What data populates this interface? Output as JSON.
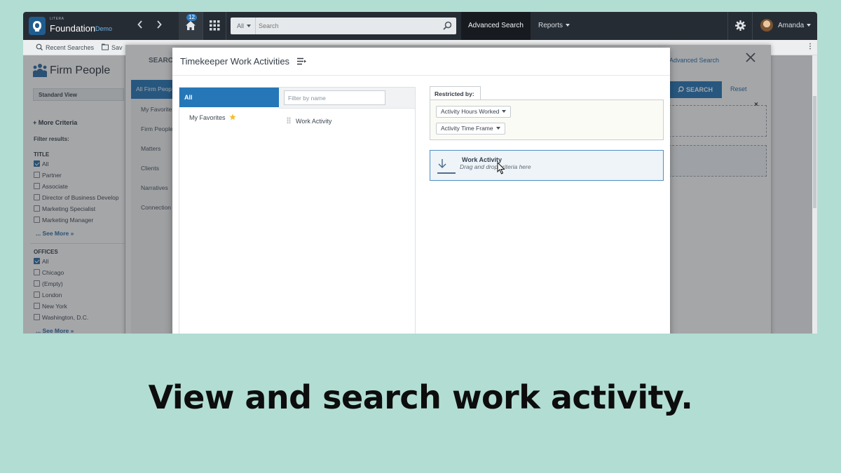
{
  "topbar": {
    "brand_small": "LITERA",
    "brand": "Foundation",
    "brand_tag": "Demo",
    "home_badge": "12",
    "search_scope": "All",
    "search_placeholder": "Search",
    "advanced_search": "Advanced Search",
    "reports": "Reports",
    "user": "Amanda"
  },
  "subbar": {
    "recent": "Recent Searches",
    "saved": "Sav"
  },
  "left_panel": {
    "title": "Firm People",
    "standard_view": "Standard View",
    "more_criteria": "+ More Criteria",
    "filter_results": "Filter results:",
    "title_section": "TITLE",
    "title_items": [
      {
        "label": "All",
        "checked": true
      },
      {
        "label": "Partner",
        "checked": false
      },
      {
        "label": "Associate",
        "checked": false
      },
      {
        "label": "Director of Business Develop",
        "checked": false
      },
      {
        "label": "Marketing Specialist",
        "checked": false
      },
      {
        "label": "Marketing Manager",
        "checked": false
      }
    ],
    "see_more_1": "... See More »",
    "offices_section": "OFFICES",
    "office_items": [
      {
        "label": "All",
        "checked": true
      },
      {
        "label": "Chicago",
        "checked": false
      },
      {
        "label": "(Empty)",
        "checked": false
      },
      {
        "label": "London",
        "checked": false
      },
      {
        "label": "New York",
        "checked": false
      },
      {
        "label": "Washington, D.C.",
        "checked": false
      }
    ],
    "see_more_2": "... See More »"
  },
  "bg_dialog": {
    "title": "SEARCI",
    "nav_active": "All Firm Peop",
    "nav_items": [
      "My Favorite",
      "Firm People",
      "Matters",
      "Clients",
      "Narratives",
      "Connection"
    ],
    "advanced_search": "Advanced Search",
    "search_button": "SEARCH",
    "reset": "Reset",
    "remove_mark": "×"
  },
  "modal": {
    "title": "Timekeeper Work Activities",
    "categories": {
      "all": "All",
      "favorites": "My Favorites"
    },
    "filter_placeholder": "Filter by name",
    "items": [
      "Work Activity"
    ],
    "restricted_by": "Restricted by:",
    "restrictions": [
      "Activity Hours Worked",
      "Activity Time Frame"
    ],
    "drop_title": "Work Activity",
    "drop_hint": "Drag and drop criteria here"
  },
  "caption": "View and search work activity.",
  "colors": {
    "background": "#b2ddd3",
    "accent": "#2677b8",
    "topbar": "#262c33"
  }
}
